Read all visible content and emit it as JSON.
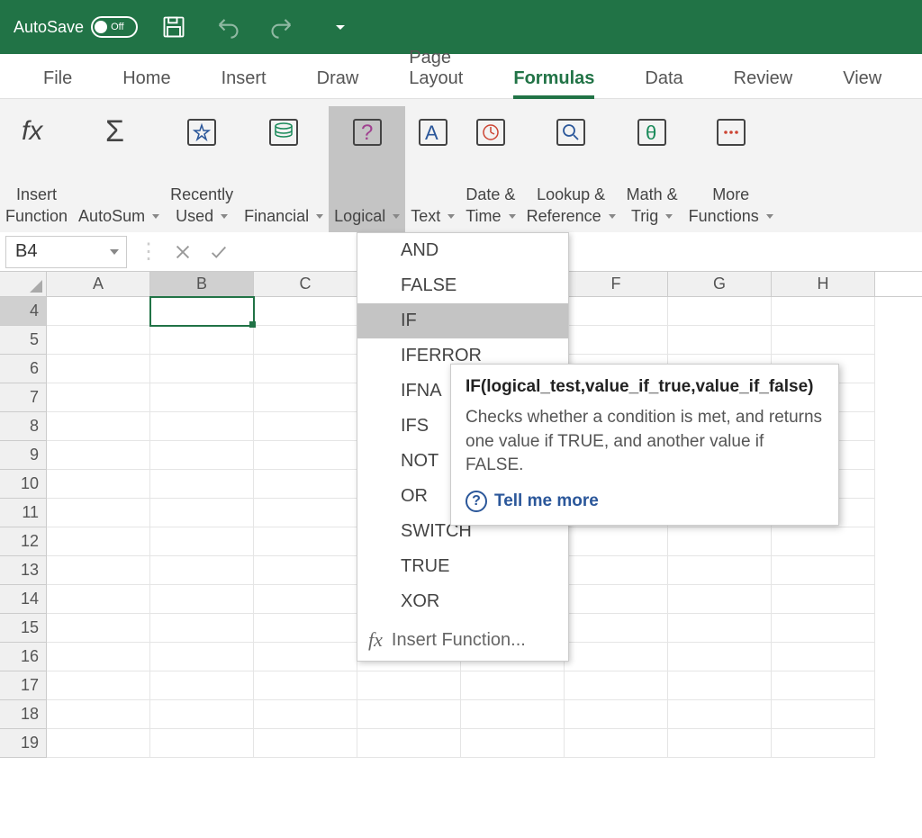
{
  "titlebar": {
    "autosave_label": "AutoSave",
    "autosave_state": "Off"
  },
  "tabs": [
    "File",
    "Home",
    "Insert",
    "Draw",
    "Page Layout",
    "Formulas",
    "Data",
    "Review",
    "View"
  ],
  "active_tab": "Formulas",
  "ribbon": [
    {
      "label": "Insert\nFunction",
      "caret": false,
      "icon": "fx"
    },
    {
      "label": "AutoSum",
      "caret": true,
      "icon": "sigma"
    },
    {
      "label": "Recently\nUsed",
      "caret": true,
      "icon": "star"
    },
    {
      "label": "Financial",
      "caret": true,
      "icon": "coins"
    },
    {
      "label": "Logical",
      "caret": true,
      "icon": "question",
      "active": true
    },
    {
      "label": "Text",
      "caret": true,
      "icon": "letterA"
    },
    {
      "label": "Date &\nTime",
      "caret": true,
      "icon": "clock"
    },
    {
      "label": "Lookup &\nReference",
      "caret": true,
      "icon": "magnifier"
    },
    {
      "label": "Math &\nTrig",
      "caret": true,
      "icon": "theta"
    },
    {
      "label": "More\nFunctions",
      "caret": true,
      "icon": "dots"
    }
  ],
  "namebox": "B4",
  "columns": [
    "A",
    "B",
    "C",
    "",
    "",
    "F",
    "G",
    "H"
  ],
  "selected_col": "B",
  "rows": [
    4,
    5,
    6,
    7,
    8,
    9,
    10,
    11,
    12,
    13,
    14,
    15,
    16,
    17,
    18,
    19
  ],
  "selected_row": 4,
  "dropdown": {
    "items": [
      "AND",
      "FALSE",
      "IF",
      "IFERROR",
      "IFNA",
      "IFS",
      "NOT",
      "OR",
      "SWITCH",
      "TRUE",
      "XOR"
    ],
    "highlight": "IF",
    "insert_label": "Insert Function..."
  },
  "tooltip": {
    "title": "IF(logical_test,value_if_true,value_if_false)",
    "body": "Checks whether a condition is met, and returns one value if TRUE, and another value if FALSE.",
    "link": "Tell me more"
  }
}
